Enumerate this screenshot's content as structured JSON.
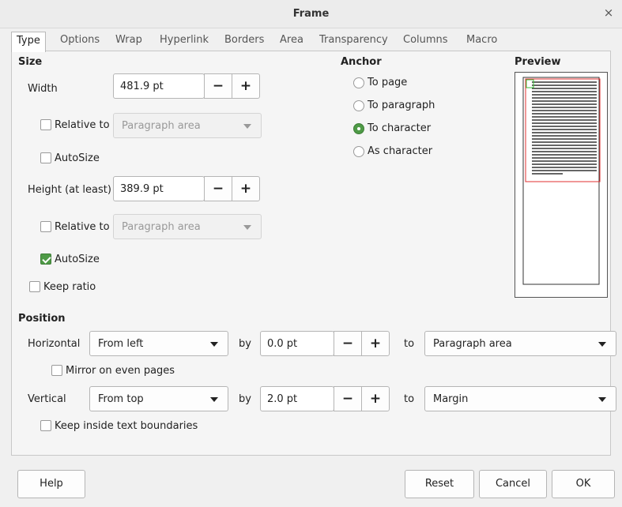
{
  "window": {
    "title": "Frame",
    "close_glyph": "×"
  },
  "tabs": [
    {
      "label": "Type"
    },
    {
      "label": "Options"
    },
    {
      "label": "Wrap"
    },
    {
      "label": "Hyperlink"
    },
    {
      "label": "Borders"
    },
    {
      "label": "Area"
    },
    {
      "label": "Transparency"
    },
    {
      "label": "Columns"
    },
    {
      "label": "Macro"
    }
  ],
  "size": {
    "heading": "Size",
    "width_label": "Width",
    "width_value": "481.9 pt",
    "relative_to_label": "Relative to",
    "width_relative_value": "Paragraph area",
    "width_relative_checked": false,
    "autosize_label": "AutoSize",
    "width_autosize_checked": false,
    "height_label": "Height (at least)",
    "height_value": "389.9 pt",
    "height_relative_value": "Paragraph area",
    "height_relative_checked": false,
    "height_autosize_checked": true,
    "keep_ratio_label": "Keep ratio",
    "keep_ratio_checked": false,
    "minus": "−",
    "plus": "+"
  },
  "anchor": {
    "heading": "Anchor",
    "options": [
      {
        "label": "To page",
        "checked": false
      },
      {
        "label": "To paragraph",
        "checked": false
      },
      {
        "label": "To character",
        "checked": true
      },
      {
        "label": "As character",
        "checked": false
      }
    ]
  },
  "preview": {
    "heading": "Preview"
  },
  "position": {
    "heading": "Position",
    "horizontal_label": "Horizontal",
    "horizontal_value": "From left",
    "by_label": "by",
    "horizontal_by_value": "0.0 pt",
    "to_label": "to",
    "horizontal_to_value": "Paragraph area",
    "mirror_label": "Mirror on even pages",
    "mirror_checked": false,
    "vertical_label": "Vertical",
    "vertical_value": "From top",
    "vertical_by_value": "2.0 pt",
    "vertical_to_value": "Margin",
    "keep_inside_label": "Keep inside text boundaries",
    "keep_inside_checked": false
  },
  "buttons": {
    "help": "Help",
    "reset": "Reset",
    "cancel": "Cancel",
    "ok": "OK"
  },
  "colors": {
    "accent": "#4e9a46",
    "preview_frame": "#e03030"
  }
}
